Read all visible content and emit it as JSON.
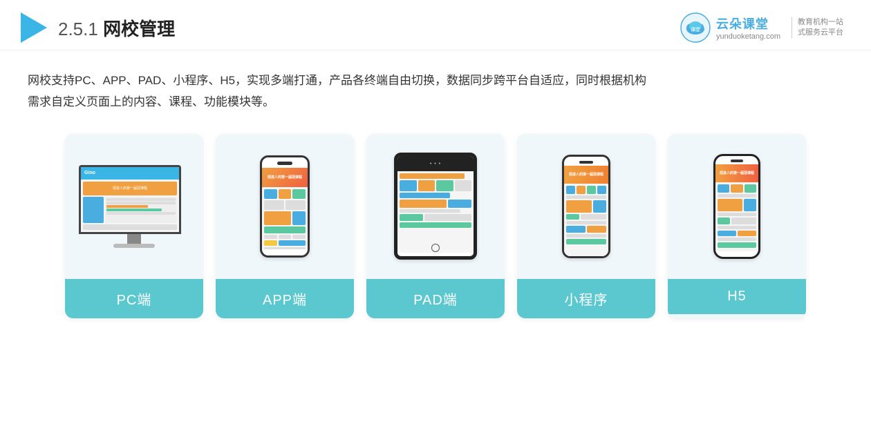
{
  "header": {
    "title_prefix": "2.5.1 ",
    "title_bold": "网校管理",
    "logo_cloud": "☁",
    "brand_name": "云朵课堂",
    "brand_url": "yunduoketang.com",
    "brand_slogan_line1": "教育机构一站",
    "brand_slogan_line2": "式服务云平台"
  },
  "description": {
    "line1": "网校支持PC、APP、PAD、小程序、H5，实现多端打通，产品各终端自由切换，数据同步跨平台自适应，同时根据机构",
    "line2": "需求自定义页面上的内容、课程、功能模块等。"
  },
  "cards": [
    {
      "id": "pc",
      "label": "PC端"
    },
    {
      "id": "app",
      "label": "APP端"
    },
    {
      "id": "pad",
      "label": "PAD端"
    },
    {
      "id": "miniprogram",
      "label": "小程序"
    },
    {
      "id": "h5",
      "label": "H5"
    }
  ]
}
